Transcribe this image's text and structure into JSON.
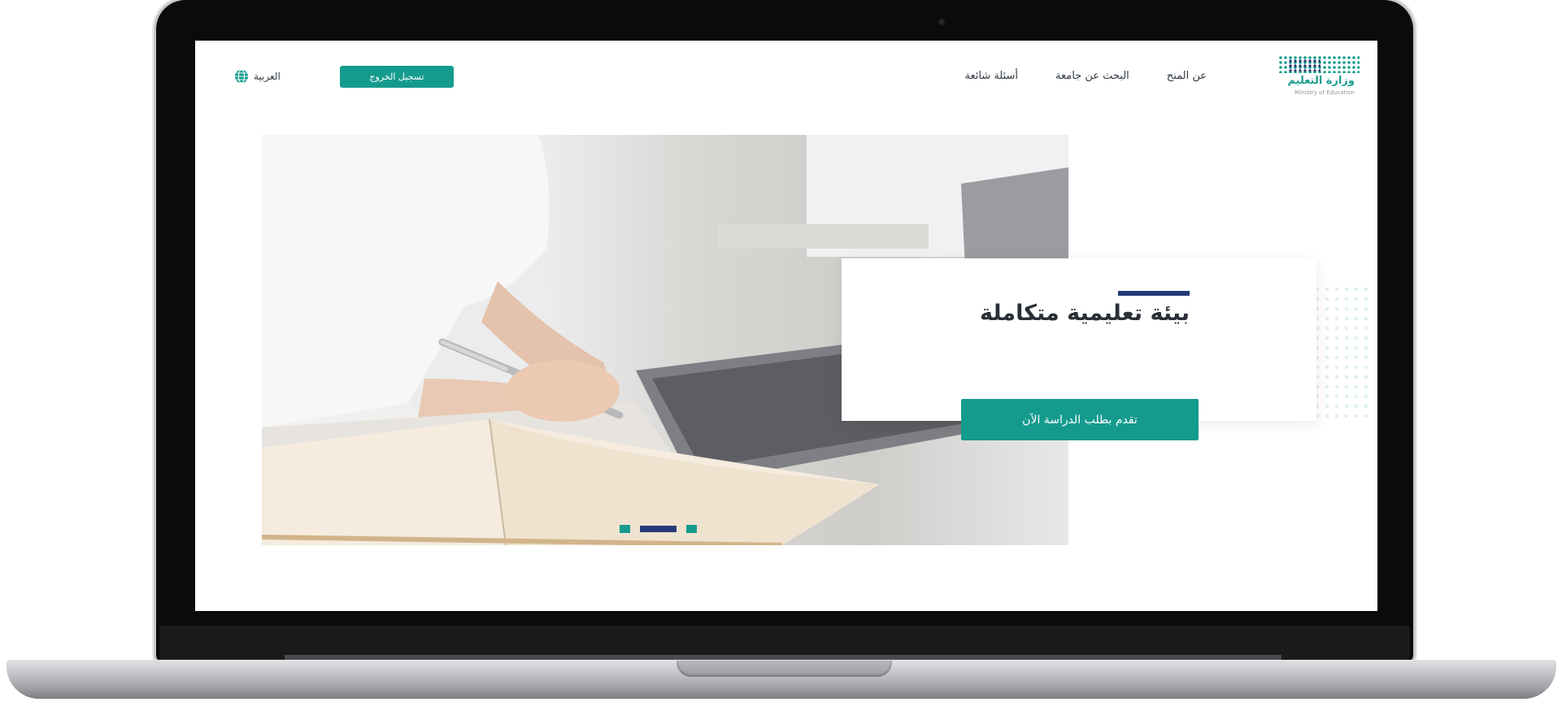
{
  "header": {
    "logo_ar": "وزارة التعليم",
    "logo_en": "Ministry of Education",
    "nav": [
      {
        "label": "عن المنح"
      },
      {
        "label": "البحث عن جامعة"
      },
      {
        "label": "أسئلة شائعة"
      }
    ],
    "logout_label": "تسجيل الخروج",
    "language_label": "العربية"
  },
  "hero": {
    "title": "بيئة تعليمية متكاملة",
    "apply_label": "تقدم بطلب الدراسة الآن",
    "carousel": {
      "slides": 3,
      "active_index": 1
    }
  },
  "colors": {
    "primary": "#159b8e",
    "accent": "#263a78",
    "text": "#2b2f36"
  },
  "icons": {
    "language": "globe-icon",
    "webcam": "camera-icon"
  }
}
